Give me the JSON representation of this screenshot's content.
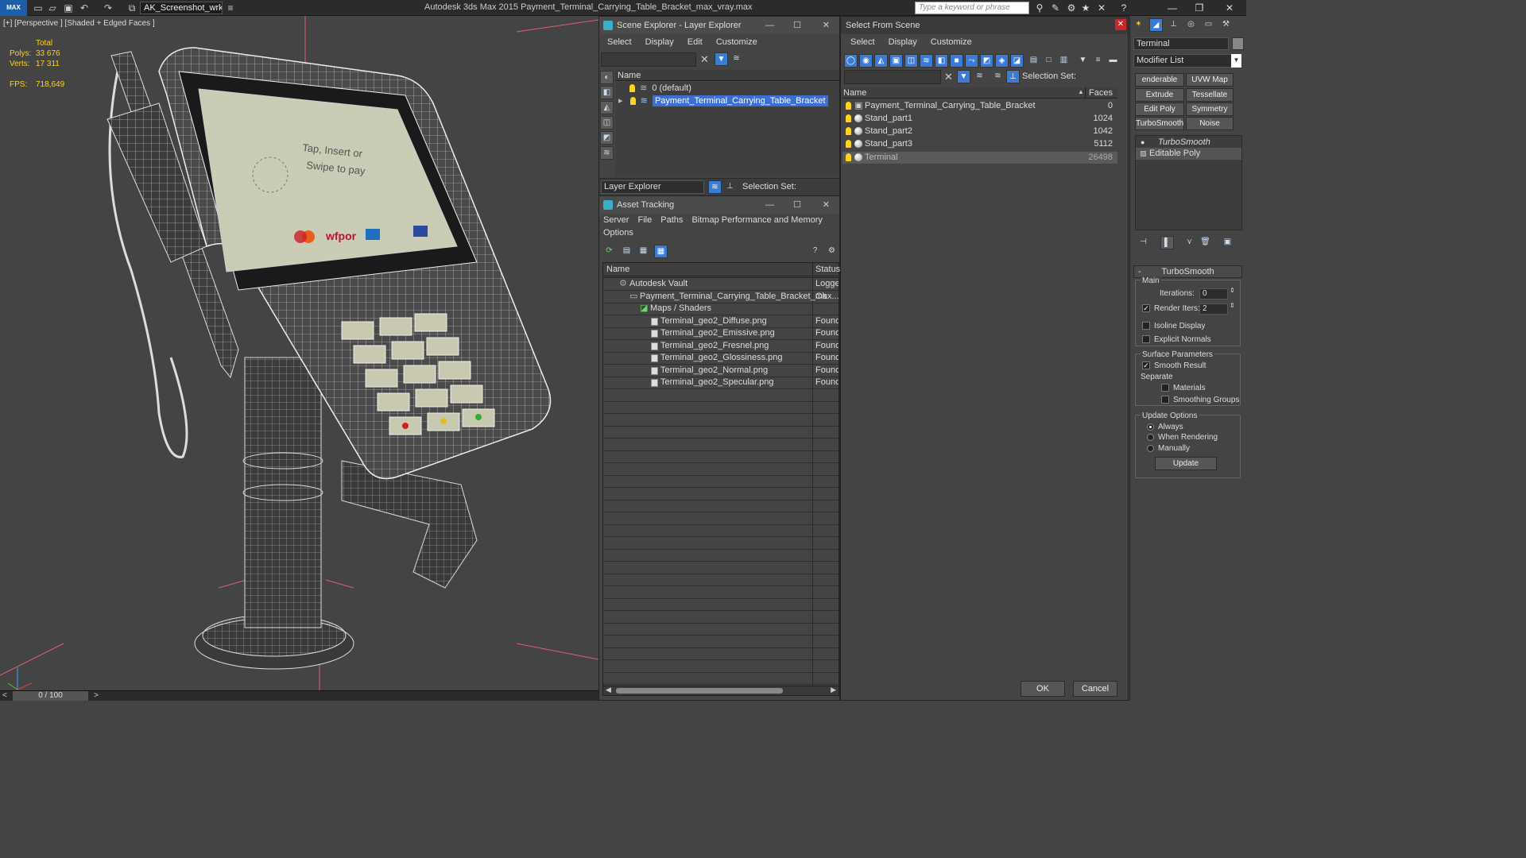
{
  "titlebar": {
    "logo": "MAX",
    "workspace": "AK_Screenshot_wrksp",
    "app_title": "Autodesk 3ds Max  2015     Payment_Terminal_Carrying_Table_Bracket_max_vray.max",
    "search_placeholder": "Type a keyword or phrase"
  },
  "viewport": {
    "label": "[+] [Perspective ] [Shaded + Edged Faces ]",
    "stats": {
      "total_label": "Total",
      "polys_label": "Polys:",
      "polys_value": "33 676",
      "verts_label": "Verts:",
      "verts_value": "17 311",
      "fps_label": "FPS:",
      "fps_value": "718,649"
    },
    "screen_text": {
      "line1": "Tap, Insert or",
      "line2": "Swipe to pay",
      "brand": "wfpor"
    }
  },
  "timeline": {
    "counter": "0 / 100",
    "prev": "<",
    "next": ">"
  },
  "scene_explorer": {
    "title": "Scene Explorer - Layer Explorer",
    "menu": [
      "Select",
      "Display",
      "Edit",
      "Customize"
    ],
    "col_name": "Name",
    "rows": [
      "0 (default)",
      "Payment_Terminal_Carrying_Table_Bracket"
    ],
    "footer_label": "Layer Explorer",
    "selection_set": "Selection Set:"
  },
  "asset_tracking": {
    "title": "Asset Tracking",
    "menu": [
      "Server",
      "File",
      "Paths",
      "Bitmap Performance and Memory"
    ],
    "menu2": "Options",
    "col_name": "Name",
    "col_status": "Status",
    "rows": [
      {
        "name": "Autodesk Vault",
        "status": "Logged"
      },
      {
        "name": "Payment_Terminal_Carrying_Table_Bracket_max...",
        "status": "Ok"
      },
      {
        "name": "Maps / Shaders",
        "status": ""
      },
      {
        "name": "Terminal_geo2_Diffuse.png",
        "status": "Found"
      },
      {
        "name": "Terminal_geo2_Emissive.png",
        "status": "Found"
      },
      {
        "name": "Terminal_geo2_Fresnel.png",
        "status": "Found"
      },
      {
        "name": "Terminal_geo2_Glossiness.png",
        "status": "Found"
      },
      {
        "name": "Terminal_geo2_Normal.png",
        "status": "Found"
      },
      {
        "name": "Terminal_geo2_Specular.png",
        "status": "Found"
      }
    ]
  },
  "select_from_scene": {
    "title": "Select From Scene",
    "menu": [
      "Select",
      "Display",
      "Customize"
    ],
    "selection_set": "Selection Set:",
    "col_name": "Name",
    "col_faces": "Faces",
    "rows": [
      {
        "name": "Payment_Terminal_Carrying_Table_Bracket",
        "faces": "0"
      },
      {
        "name": "Stand_part1",
        "faces": "1024"
      },
      {
        "name": "Stand_part2",
        "faces": "1042"
      },
      {
        "name": "Stand_part3",
        "faces": "5112"
      },
      {
        "name": "Terminal",
        "faces": "26498"
      }
    ],
    "ok": "OK",
    "cancel": "Cancel"
  },
  "command_panel": {
    "object_name": "Terminal",
    "modifier_list": "Modifier List",
    "buttons": [
      "enderable Spli",
      "UVW Map",
      "Extrude",
      "Tessellate",
      "Edit Poly",
      "Symmetry",
      "TurboSmooth",
      "Noise"
    ],
    "stack": [
      "TurboSmooth",
      "Editable Poly"
    ],
    "rollout_title": "TurboSmooth",
    "main_label": "Main",
    "iterations_label": "Iterations:",
    "iterations_value": "0",
    "render_iters_label": "Render Iters:",
    "render_iters_value": "2",
    "isoline": "Isoline Display",
    "explicit_normals": "Explicit Normals",
    "surface_params": "Surface Parameters",
    "smooth_result": "Smooth Result",
    "separate": "Separate",
    "materials": "Materials",
    "smoothing_groups": "Smoothing Groups",
    "update_options": "Update Options",
    "always": "Always",
    "when_rendering": "When Rendering",
    "manually": "Manually",
    "update": "Update"
  }
}
